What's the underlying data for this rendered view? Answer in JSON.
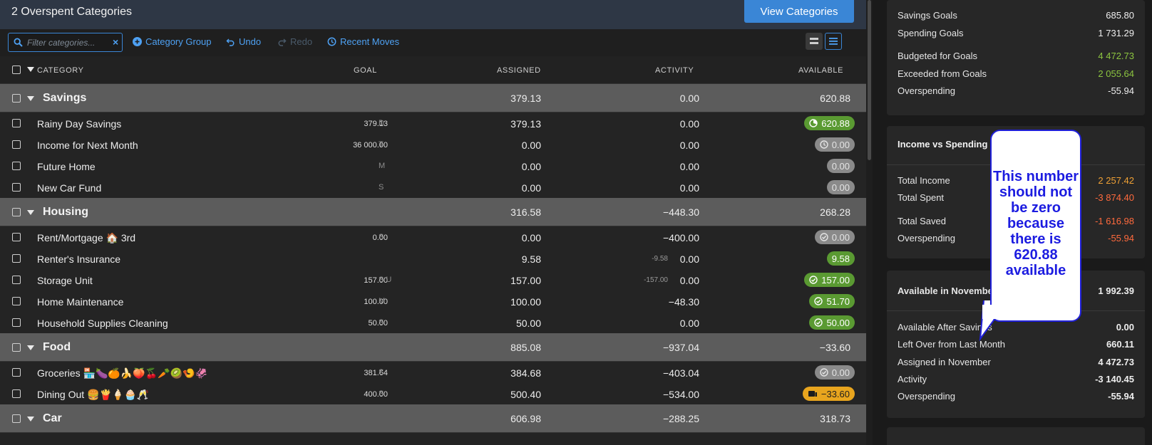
{
  "header": {
    "title": "2 Overspent Categories",
    "view_categories_label": "View Categories"
  },
  "toolbar": {
    "filter_placeholder": "Filter categories...",
    "clear_label": "×",
    "category_group_label": "Category Group",
    "undo_label": "Undo",
    "redo_label": "Redo",
    "recent_moves_label": "Recent Moves"
  },
  "columns": {
    "category": "CATEGORY",
    "goal": "GOAL",
    "assigned": "ASSIGNED",
    "activity": "ACTIVITY",
    "available": "AVAILABLE"
  },
  "colors": {
    "accent": "#3a86d6",
    "green": "#5a9a32",
    "orange": "#e8a51e",
    "grey": "#8a8a8a",
    "red_text": "#ff6a3d",
    "green_text": "#8cc540"
  },
  "rows": [
    {
      "type": "group",
      "name": "Savings",
      "assigned": "379.13",
      "activity": "0.00",
      "available": "620.88"
    },
    {
      "type": "item",
      "name": "Rainy Day Savings",
      "goal": "379.13",
      "goal_type": "D",
      "assigned": "379.13",
      "activity": "0.00",
      "available": "620.88",
      "pill": "green",
      "icon": "progress-icon"
    },
    {
      "type": "item",
      "name": "Income for Next Month",
      "goal": "36 000.00",
      "goal_type": "T",
      "assigned": "0.00",
      "activity": "0.00",
      "available": "0.00",
      "pill": "grey",
      "icon": "clock-icon"
    },
    {
      "type": "item",
      "name": "Future Home",
      "goal": "",
      "goal_type": "M",
      "assigned": "0.00",
      "activity": "0.00",
      "available": "0.00",
      "pill": "grey",
      "icon": ""
    },
    {
      "type": "item",
      "name": "New Car Fund",
      "goal": "",
      "goal_type": "S",
      "assigned": "0.00",
      "activity": "0.00",
      "available": "0.00",
      "pill": "grey",
      "icon": ""
    },
    {
      "type": "group",
      "name": "Housing",
      "assigned": "316.58",
      "activity": "−448.30",
      "available": "268.28"
    },
    {
      "type": "item",
      "name": "Rent/Mortgage 🏠 3rd",
      "goal": "0.00",
      "goal_type": "S",
      "assigned": "0.00",
      "activity": "−400.00",
      "available": "0.00",
      "pill": "grey",
      "icon": "check-icon"
    },
    {
      "type": "item",
      "name": "Renter's Insurance",
      "goal": "",
      "goal_type": "",
      "assigned": "9.58",
      "activity_sub": "-9.58",
      "activity": "0.00",
      "available": "9.58",
      "pill": "green",
      "icon": ""
    },
    {
      "type": "item",
      "name": "Storage Unit",
      "goal": "157.00",
      "goal_type": "S U",
      "assigned": "157.00",
      "activity_sub": "-157.00",
      "activity": "0.00",
      "available": "157.00",
      "pill": "green",
      "icon": "check-icon"
    },
    {
      "type": "item",
      "name": "Home Maintenance",
      "goal": "100.00",
      "goal_type": "M",
      "assigned": "100.00",
      "activity": "−48.30",
      "available": "51.70",
      "pill": "green",
      "icon": "check-icon"
    },
    {
      "type": "item",
      "name": "Household Supplies Cleaning",
      "goal": "50.00",
      "goal_type": "S",
      "assigned": "50.00",
      "activity": "0.00",
      "available": "50.00",
      "pill": "green",
      "icon": "check-icon"
    },
    {
      "type": "group",
      "name": "Food",
      "assigned": "885.08",
      "activity": "−937.04",
      "available": "−33.60"
    },
    {
      "type": "item",
      "name": "Groceries 🏪🍆🍊🍌🍑🍒🥕🥝🍤🦑",
      "goal": "381.64",
      "goal_type": "S",
      "assigned": "384.68",
      "activity": "−403.04",
      "available": "0.00",
      "pill": "grey",
      "icon": "check-icon"
    },
    {
      "type": "item",
      "name": "Dining Out 🍔🍟🍦🧁🥂",
      "goal": "400.00",
      "goal_type": "S",
      "assigned": "500.40",
      "activity": "−534.00",
      "available": "−33.60",
      "pill": "orange",
      "icon": "card-icon"
    },
    {
      "type": "group",
      "name": "Car",
      "assigned": "606.98",
      "activity": "−288.25",
      "available": "318.73"
    }
  ],
  "summary": {
    "goals": [
      {
        "label": "Savings Goals",
        "value": "685.80",
        "style": ""
      },
      {
        "label": "Spending Goals",
        "value": "1 731.29",
        "style": ""
      },
      {
        "label": "Budgeted for Goals",
        "value": "4 472.73",
        "style": "green"
      },
      {
        "label": "Exceeded from Goals",
        "value": "2 055.64",
        "style": "green"
      },
      {
        "label": "Overspending",
        "value": "-55.94",
        "style": ""
      }
    ],
    "income_vs_spending": {
      "title": "Income vs Spending",
      "items": [
        {
          "label": "Total Income",
          "value": "2 257.42",
          "style": "orange"
        },
        {
          "label": "Total Spent",
          "value": "-3 874.40",
          "style": "red"
        },
        {
          "label": "Total Saved",
          "value": "-1 616.98",
          "style": "red"
        },
        {
          "label": "Overspending",
          "value": "-55.94",
          "style": "red"
        }
      ]
    },
    "available": {
      "title": "Available in November",
      "value": "1 992.39",
      "items": [
        {
          "label": "Available After Savings",
          "value": "0.00",
          "style": ""
        },
        {
          "label": "Left Over from Last Month",
          "value": "660.11",
          "style": ""
        },
        {
          "label": "Assigned in November",
          "value": "4 472.73",
          "style": ""
        },
        {
          "label": "Activity",
          "value": "-3 140.45",
          "style": ""
        },
        {
          "label": "Overspending",
          "value": "-55.94",
          "style": ""
        }
      ]
    }
  },
  "callout": {
    "text": "This number should not be zero because there is 620.88 available"
  }
}
